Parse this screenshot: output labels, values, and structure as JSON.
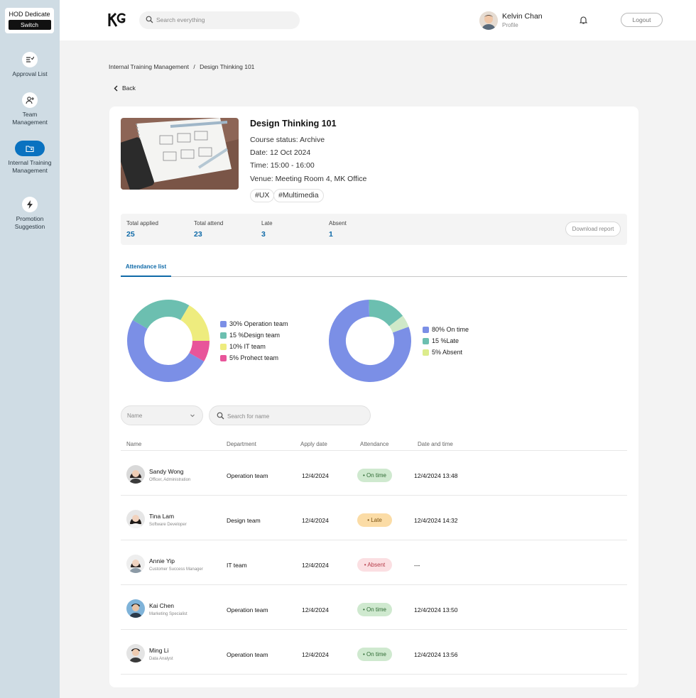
{
  "sidebar": {
    "role": "HOD Dedicate",
    "switch_label": "Switch",
    "items": [
      {
        "label": "Approval List",
        "icon": "checklist-icon"
      },
      {
        "label": "Team Management",
        "icon": "add-user-icon"
      },
      {
        "label": "Internal Training Management",
        "icon": "folder-user-icon",
        "active": true
      },
      {
        "label": "Promotion Suggestion",
        "icon": "lightning-icon"
      }
    ]
  },
  "header": {
    "search_placeholder": "Search everything",
    "user_name": "Kelvin Chan",
    "user_role": "Profile",
    "logout_label": "Logout"
  },
  "breadcrumb": {
    "parent": "Internal Training Management",
    "separator": "/",
    "current": "Design Thinking 101"
  },
  "back_label": "Back",
  "course": {
    "title": "Design Thinking 101",
    "status_label": "Course status:",
    "status": "Archive",
    "date_label": "Date:",
    "date": "12 Oct 2024",
    "time_label": "Time:",
    "time": "15:00 - 16:00",
    "venue_label": "Venue:",
    "venue": "Meeting Room 4, MK Office",
    "tags": [
      "#UX",
      "#Multimedia"
    ]
  },
  "stats": [
    {
      "label": "Total applied",
      "value": "25"
    },
    {
      "label": "Total attend",
      "value": "23"
    },
    {
      "label": "Late",
      "value": "3"
    },
    {
      "label": "Absent",
      "value": "1"
    }
  ],
  "download_label": "Download report",
  "tab_label": "Attendance list",
  "charts": {
    "team_legend": [
      "30% Operation team",
      "15 %Design team",
      "10% IT team",
      "5% Prohect team"
    ],
    "status_legend": [
      "80% On time",
      "15 %Late",
      "5% Absent"
    ]
  },
  "chart_data": [
    {
      "type": "pie",
      "categories": [
        "Operation team",
        "Design team",
        "IT team",
        "Prohect team"
      ],
      "values": [
        30,
        15,
        10,
        5
      ],
      "colors": [
        "#7b8fe6",
        "#6cbfb0",
        "#eeec7e",
        "#e8559a"
      ]
    },
    {
      "type": "pie",
      "categories": [
        "On time",
        "Late",
        "Absent"
      ],
      "values": [
        80,
        15,
        5
      ],
      "colors": [
        "#7b8fe6",
        "#6cbfb0",
        "#cfe9c8"
      ]
    }
  ],
  "filters": {
    "name_select": "Name",
    "search_placeholder": "Search for name"
  },
  "table": {
    "headers": [
      "Name",
      "Department",
      "Apply date",
      "Attendance",
      "Date and time"
    ],
    "rows": [
      {
        "name": "Sandy Wong",
        "role": "Officer, Administration",
        "dept": "Operation team",
        "apply": "12/4/2024",
        "status": "On time",
        "datetime": "12/4/2024 13:48"
      },
      {
        "name": "Tina Lam",
        "role": "Software Developer",
        "dept": "Design team",
        "apply": "12/4/2024",
        "status": "Late",
        "datetime": "12/4/2024 14:32"
      },
      {
        "name": "Annie Yip",
        "role": "Customer Success Manager",
        "dept": "IT team",
        "apply": "12/4/2024",
        "status": "Absent",
        "datetime": "---"
      },
      {
        "name": "Kai Chen",
        "role": "Marketing Specialist",
        "dept": "Operation team",
        "apply": "12/4/2024",
        "status": "On time",
        "datetime": "12/4/2024 13:50"
      },
      {
        "name": "Ming Li",
        "role": "Data Analyst",
        "dept": "Operation team",
        "apply": "12/4/2024",
        "status": "On time",
        "datetime": "12/4/2024 13:56"
      }
    ]
  },
  "colors": {
    "sidebar_bg": "#cfdce4",
    "accent": "#0f6aa8",
    "active_nav": "#0a72c0"
  }
}
